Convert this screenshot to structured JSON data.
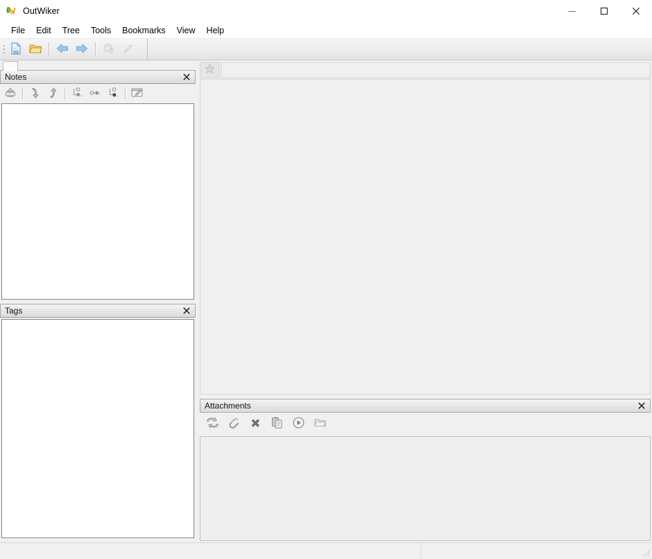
{
  "window": {
    "title": "OutWiker",
    "icon": "outwiker-logo-icon",
    "controls": {
      "minimize_label": "Minimize",
      "maximize_label": "Maximize",
      "close_label": "Close"
    }
  },
  "menubar": {
    "items": [
      {
        "label": "File",
        "name": "menu-file"
      },
      {
        "label": "Edit",
        "name": "menu-edit"
      },
      {
        "label": "Tree",
        "name": "menu-tree"
      },
      {
        "label": "Tools",
        "name": "menu-tools"
      },
      {
        "label": "Bookmarks",
        "name": "menu-bookmarks"
      },
      {
        "label": "View",
        "name": "menu-view"
      },
      {
        "label": "Help",
        "name": "menu-help"
      }
    ]
  },
  "toolbar": {
    "grip_label": "Toolbar drag handle",
    "buttons": [
      {
        "icon": "new-page-icon",
        "label": "New page",
        "enabled": true
      },
      {
        "icon": "open-folder-icon",
        "label": "Open tree",
        "enabled": true
      },
      {
        "icon": "back-arrow-icon",
        "label": "Back",
        "enabled": true
      },
      {
        "icon": "forward-arrow-icon",
        "label": "Forward",
        "enabled": true
      },
      {
        "icon": "global-search-icon",
        "label": "Global search",
        "enabled": false
      },
      {
        "icon": "edit-pencil-icon",
        "label": "Edit page properties",
        "enabled": false
      }
    ]
  },
  "notes_panel": {
    "title": "Notes",
    "close_label": "Close Notes panel",
    "toolbar": [
      {
        "icon": "move-to-parent-icon",
        "label": "Move page to parent"
      },
      {
        "icon": "move-down-icon",
        "label": "Move page down"
      },
      {
        "icon": "move-up-icon",
        "label": "Move page up"
      },
      {
        "icon": "add-child-page-icon",
        "label": "Add child page"
      },
      {
        "icon": "add-sibling-page-icon",
        "label": "Add sibling page"
      },
      {
        "icon": "remove-page-icon",
        "label": "Remove page"
      },
      {
        "icon": "rename-page-icon",
        "label": "Rename page"
      }
    ],
    "tree_items": []
  },
  "tags_panel": {
    "title": "Tags",
    "close_label": "Close Tags panel",
    "tags": []
  },
  "page_header": {
    "bookmark_icon": "star-icon",
    "bookmark_label": "Add to bookmarks",
    "title_value": "",
    "title_placeholder": ""
  },
  "editor": {
    "content": ""
  },
  "attachments_panel": {
    "title": "Attachments",
    "close_label": "Close Attachments panel",
    "toolbar": [
      {
        "icon": "refresh-icon",
        "label": "Refresh attachments"
      },
      {
        "icon": "paperclip-icon",
        "label": "Attach files"
      },
      {
        "icon": "delete-x-icon",
        "label": "Remove attachments"
      },
      {
        "icon": "paste-clipboard-icon",
        "label": "Paste attachment link"
      },
      {
        "icon": "execute-play-icon",
        "label": "Execute attachment"
      },
      {
        "icon": "open-attach-folder-icon",
        "label": "Open attachments folder"
      }
    ],
    "files": []
  },
  "statusbar": {
    "left_text": "",
    "right_text": "",
    "grip_label": "Resize window"
  },
  "colors": {
    "window_bg": "#f0f0f0",
    "titlebar_bg": "#ffffff",
    "panel_caption_start": "#f3f3f3",
    "panel_caption_end": "#dcdcdc",
    "tree_bg": "#ffffff",
    "border": "#848484",
    "icon_blue": "#7fb2e5",
    "icon_folder": "#f0b83c",
    "logo_green": "#4e9a28",
    "logo_orange": "#e8920c"
  }
}
